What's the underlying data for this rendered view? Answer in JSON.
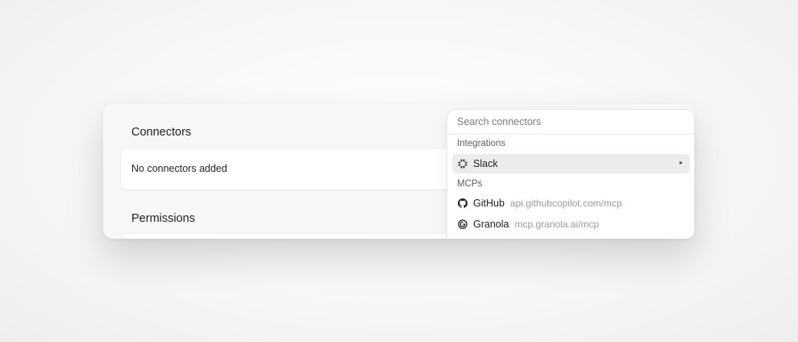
{
  "connectors": {
    "title": "Connectors",
    "empty_text": "No connectors added"
  },
  "permissions": {
    "title": "Permissions"
  },
  "dropdown": {
    "search_placeholder": "Search connectors",
    "integrations_label": "Integrations",
    "integrations": [
      {
        "name": "Slack",
        "icon": "slack-icon",
        "has_submenu": true,
        "highlighted": true
      }
    ],
    "mcps_label": "MCPs",
    "mcps": [
      {
        "name": "GitHub",
        "url": "api.githubcopilot.com/mcp",
        "icon": "github-icon"
      },
      {
        "name": "Granola",
        "url": "mcp.granola.ai/mcp",
        "icon": "granola-icon"
      }
    ],
    "submenu_arrow": "▸"
  },
  "colors": {
    "highlight": "#ececec",
    "muted_text": "#9a9a9a"
  }
}
